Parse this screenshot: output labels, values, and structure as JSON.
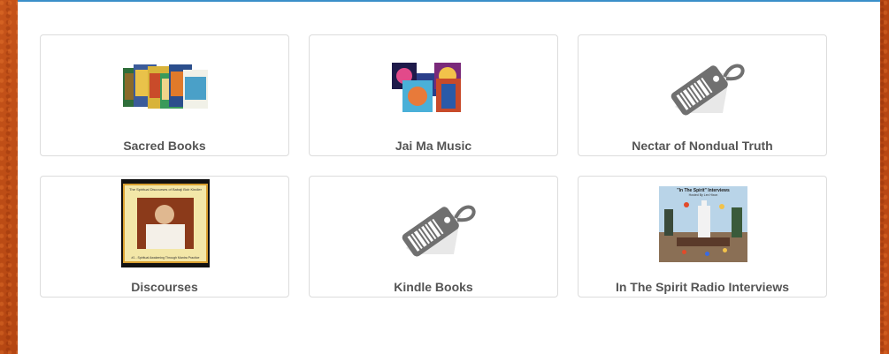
{
  "categories": [
    {
      "label": "Sacred Books",
      "icon": "book-collection-thumbnail"
    },
    {
      "label": "Jai Ma Music",
      "icon": "music-albums-thumbnail"
    },
    {
      "label": "Nectar of Nondual Truth",
      "icon": "price-tag-icon"
    },
    {
      "label": "Discourses",
      "icon": "discourse-book-cover"
    },
    {
      "label": "Kindle Books",
      "icon": "price-tag-icon"
    },
    {
      "label": "In The Spirit Radio Interviews",
      "icon": "radio-interviews-cover"
    }
  ],
  "colors": {
    "accent": "#3a8fc9",
    "label": "#555555",
    "background": "#b94a12"
  },
  "discourse_cover": {
    "title": "The Spiritual Discourses of Babaji Bob Kindler",
    "subtitle": "#1 - Spiritual Awakening Through Mantra Practice"
  },
  "radio_cover": {
    "title": "\"In The Spirit\" Interviews",
    "subtitle": "Hosted By Lex Hixon"
  }
}
